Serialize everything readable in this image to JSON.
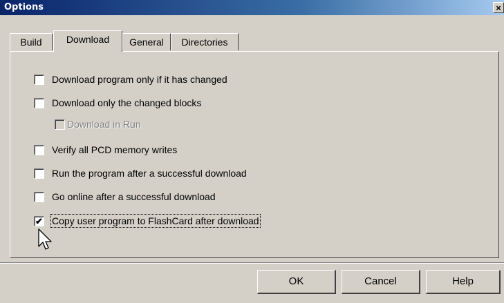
{
  "window": {
    "title": "Options",
    "close_glyph": "×"
  },
  "tabs": [
    {
      "label": "Build",
      "active": false
    },
    {
      "label": "Download",
      "active": true
    },
    {
      "label": "General",
      "active": false
    },
    {
      "label": "Directories",
      "active": false
    }
  ],
  "options": [
    {
      "label": "Download program only if it has changed",
      "checked": false,
      "enabled": true
    },
    {
      "label": "Download only the changed blocks",
      "checked": false,
      "enabled": true
    },
    {
      "label": "Download in Run",
      "checked": false,
      "enabled": false
    },
    {
      "label": "Verify all PCD memory writes",
      "checked": false,
      "enabled": true
    },
    {
      "label": "Run the program after a successful download",
      "checked": false,
      "enabled": true
    },
    {
      "label": "Go online after a successful download",
      "checked": false,
      "enabled": true
    },
    {
      "label": "Copy user program to FlashCard after download",
      "checked": true,
      "enabled": true,
      "focused": true
    }
  ],
  "buttons": {
    "ok": "OK",
    "cancel": "Cancel",
    "help": "Help"
  },
  "check_glyph": "✔"
}
